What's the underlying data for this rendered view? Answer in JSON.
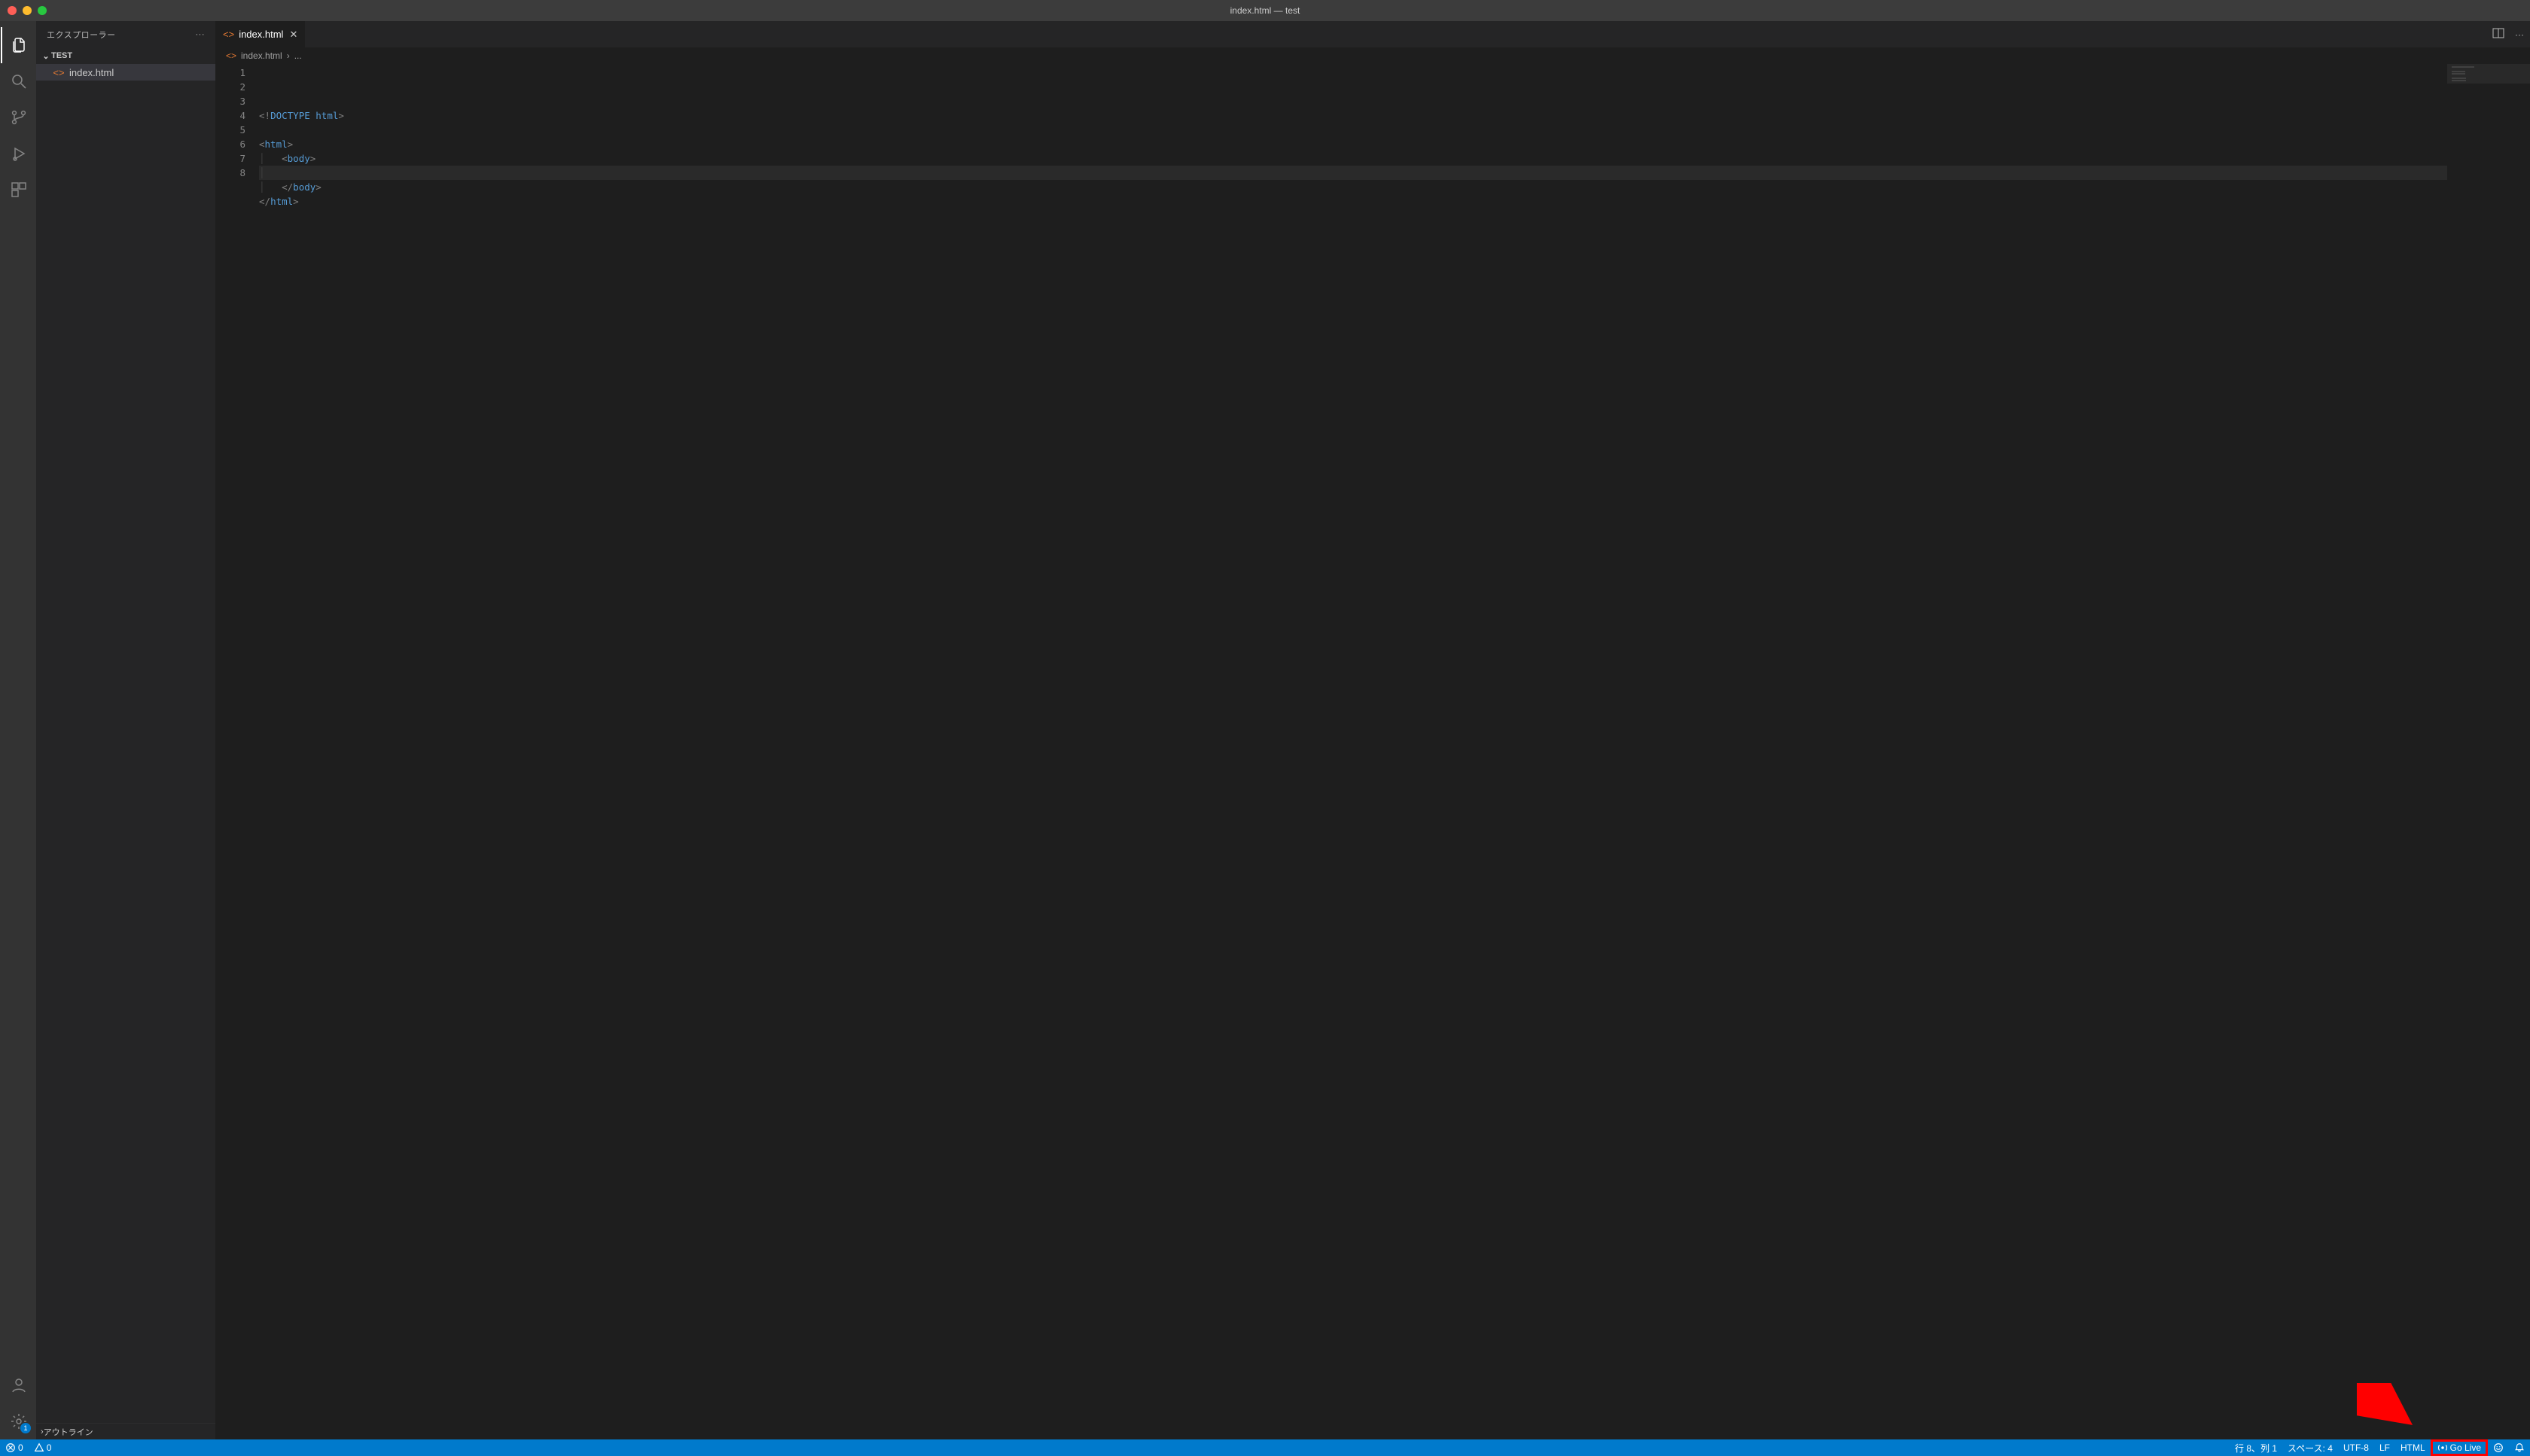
{
  "title": "index.html — test",
  "sidebar": {
    "header": "エクスプローラー",
    "folder": "TEST",
    "files": [
      {
        "name": "index.html"
      }
    ],
    "outline_label": "アウトライン"
  },
  "tabs": [
    {
      "label": "index.html",
      "active": true
    }
  ],
  "breadcrumb": {
    "file": "index.html",
    "trail": "..."
  },
  "editor": {
    "lines": [
      1,
      2,
      3,
      4,
      5,
      6,
      7,
      8
    ],
    "current_line_index": 7,
    "code": [
      {
        "indent": 0,
        "segments": [
          {
            "t": "<!",
            "c": "gray"
          },
          {
            "t": "DOCTYPE",
            "c": "doctype"
          },
          {
            "t": " ",
            "c": "text"
          },
          {
            "t": "html",
            "c": "tag"
          },
          {
            "t": ">",
            "c": "gray"
          }
        ]
      },
      {
        "indent": 0,
        "segments": []
      },
      {
        "indent": 0,
        "segments": [
          {
            "t": "<",
            "c": "gray"
          },
          {
            "t": "html",
            "c": "tag"
          },
          {
            "t": ">",
            "c": "gray"
          }
        ]
      },
      {
        "indent": 1,
        "segments": [
          {
            "t": "<",
            "c": "gray"
          },
          {
            "t": "body",
            "c": "tag"
          },
          {
            "t": ">",
            "c": "gray"
          }
        ]
      },
      {
        "indent": 1,
        "segments": []
      },
      {
        "indent": 1,
        "segments": [
          {
            "t": "</",
            "c": "gray"
          },
          {
            "t": "body",
            "c": "tag"
          },
          {
            "t": ">",
            "c": "gray"
          }
        ]
      },
      {
        "indent": 0,
        "segments": [
          {
            "t": "</",
            "c": "gray"
          },
          {
            "t": "html",
            "c": "tag"
          },
          {
            "t": ">",
            "c": "gray"
          }
        ]
      },
      {
        "indent": 0,
        "segments": []
      }
    ]
  },
  "activity_badge": "1",
  "statusbar": {
    "errors": "0",
    "warnings": "0",
    "cursor": "行 8、列 1",
    "spaces": "スペース: 4",
    "encoding": "UTF-8",
    "eol": "LF",
    "language": "HTML",
    "golive": "Go Live"
  },
  "colors": {
    "accent": "#007acc",
    "annotation": "#ff0000"
  }
}
